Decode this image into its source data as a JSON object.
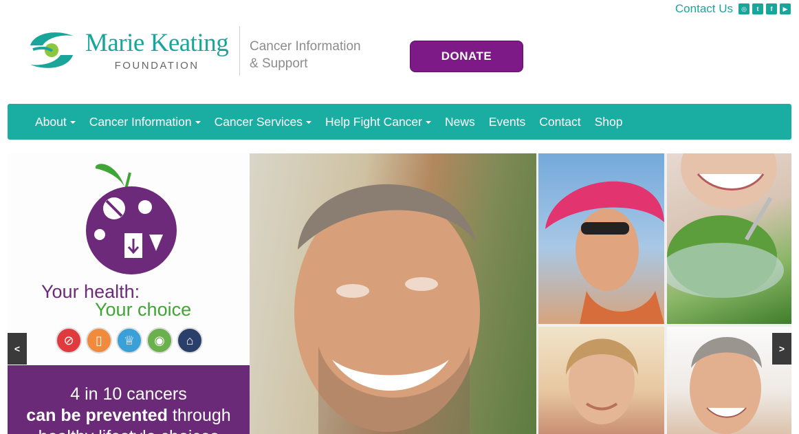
{
  "topbar": {
    "contact_label": "Contact Us",
    "social": [
      {
        "name": "instagram-icon",
        "glyph": "◎"
      },
      {
        "name": "twitter-icon",
        "glyph": "t"
      },
      {
        "name": "facebook-icon",
        "glyph": "f"
      },
      {
        "name": "youtube-icon",
        "glyph": "▶"
      }
    ]
  },
  "brand": {
    "name": "Marie Keating",
    "subname": "FOUNDATION",
    "tagline_1": "Cancer Information",
    "tagline_2": "& Support",
    "colors": {
      "teal": "#1aa59a",
      "purple": "#7d1a87",
      "green": "#8dc63f"
    }
  },
  "donate_label": "DONATE",
  "nav": {
    "items": [
      {
        "label": "About",
        "dropdown": true
      },
      {
        "label": "Cancer Information",
        "dropdown": true
      },
      {
        "label": "Cancer Services",
        "dropdown": true
      },
      {
        "label": "Help Fight Cancer",
        "dropdown": true
      },
      {
        "label": "News",
        "dropdown": false
      },
      {
        "label": "Events",
        "dropdown": false
      },
      {
        "label": "Contact",
        "dropdown": false
      },
      {
        "label": "Shop",
        "dropdown": false
      }
    ]
  },
  "slide": {
    "headline_1": "Your health:",
    "headline_2": "Your choice",
    "stat_1": "4 in 10 cancers",
    "stat_2_bold": "can be prevented",
    "stat_2_rest": " through",
    "stat_3": "healthy lifestyle choices",
    "prev_label": "<",
    "next_label": ">"
  }
}
